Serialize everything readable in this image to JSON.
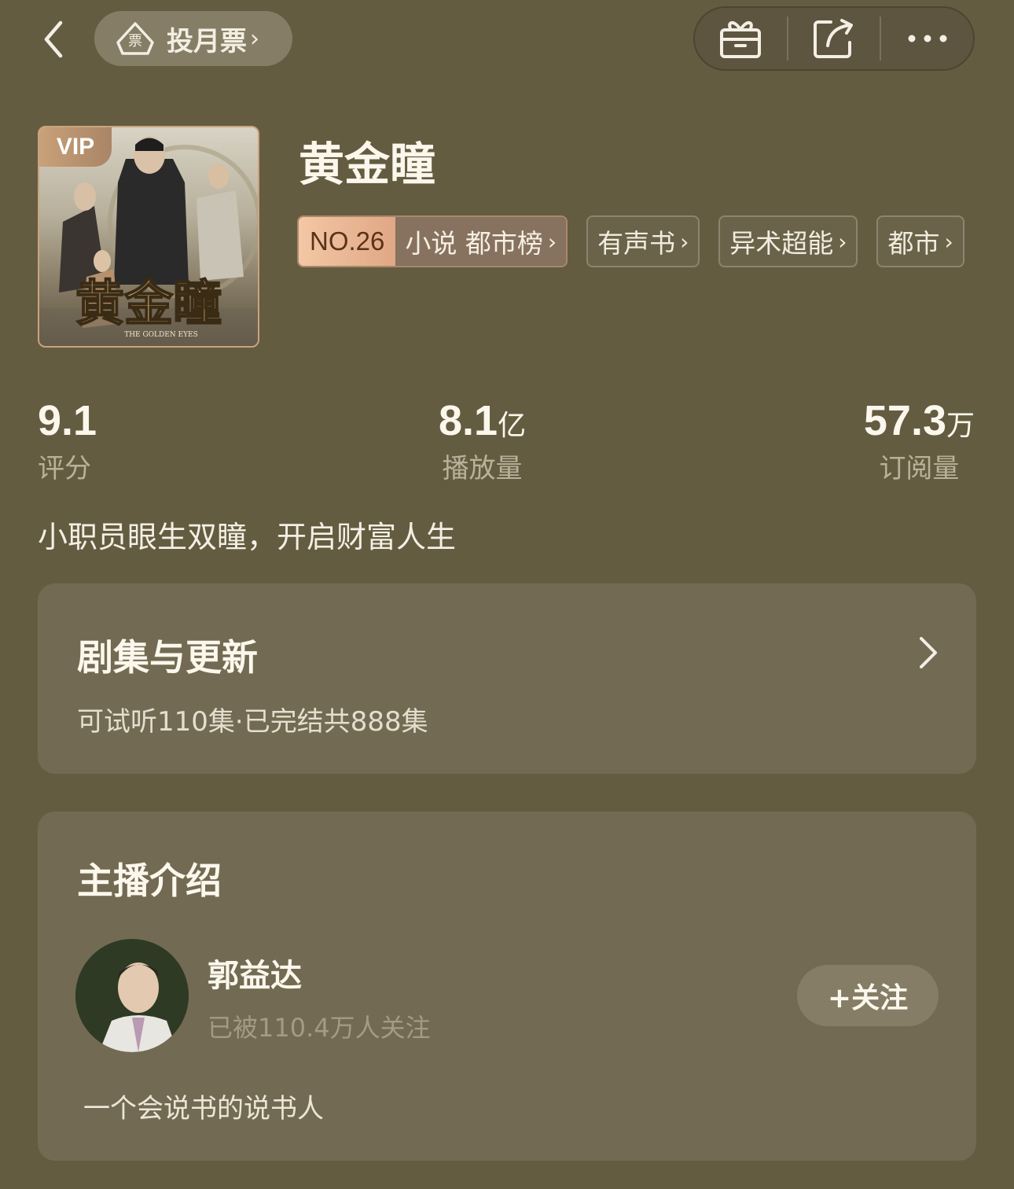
{
  "topbar": {
    "vote_label": "投月票",
    "vote_chevron": "›",
    "ticket_text": "票",
    "icons": [
      "back-icon",
      "ticket-icon",
      "gift-icon",
      "share-icon",
      "more-icon"
    ]
  },
  "book": {
    "title": "黄金瞳",
    "vip_label": "VIP",
    "cover_text": "黄金瞳",
    "cover_subtext": "THE GOLDEN EYES",
    "rank_no": "NO.26",
    "rank_list": "小说 都市榜",
    "tags": [
      "有声书",
      "异术超能",
      "都市"
    ]
  },
  "stats": [
    {
      "value": "9.1",
      "unit": "",
      "label": "评分"
    },
    {
      "value": "8.1",
      "unit": "亿",
      "label": "播放量"
    },
    {
      "value": "57.3",
      "unit": "万",
      "label": "订阅量"
    }
  ],
  "description": "小职员眼生双瞳，开启财富人生",
  "episodes": {
    "title": "剧集与更新",
    "subtitle": "可试听110集·已完结共888集"
  },
  "host": {
    "section_title": "主播介绍",
    "name": "郭益达",
    "followers": "已被110.4万人关注",
    "follow_label": "+关注",
    "bio": "一个会说书的说书人"
  },
  "colors": {
    "background": "#645c41",
    "card": "#726a52",
    "rank_accent": "#e0a785"
  }
}
